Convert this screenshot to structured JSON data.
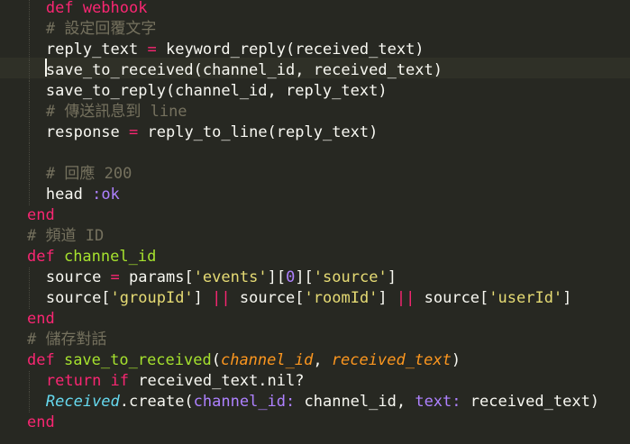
{
  "editor": {
    "lines": [
      {
        "indent": 2,
        "tokens": [
          {
            "t": "def webhook",
            "c": "kw"
          }
        ]
      },
      {
        "indent": 2,
        "tokens": [
          {
            "t": "# 設定回覆文字",
            "c": "cm"
          }
        ]
      },
      {
        "indent": 2,
        "tokens": [
          {
            "t": "reply_text ",
            "c": "plain"
          },
          {
            "t": "=",
            "c": "op"
          },
          {
            "t": " keyword_reply(received_text)",
            "c": "plain"
          }
        ]
      },
      {
        "indent": 2,
        "tokens": [
          {
            "t": "save_to_received(channel_id, received_text)",
            "c": "plain"
          }
        ],
        "cursor": true
      },
      {
        "indent": 2,
        "tokens": [
          {
            "t": "save_to_reply(channel_id, reply_text)",
            "c": "plain"
          }
        ]
      },
      {
        "indent": 2,
        "tokens": [
          {
            "t": "# 傳送訊息到 line",
            "c": "cm"
          }
        ]
      },
      {
        "indent": 2,
        "tokens": [
          {
            "t": "response ",
            "c": "plain"
          },
          {
            "t": "=",
            "c": "op"
          },
          {
            "t": " reply_to_line(reply_text)",
            "c": "plain"
          }
        ]
      },
      {
        "indent": 2,
        "tokens": []
      },
      {
        "indent": 2,
        "tokens": [
          {
            "t": "# 回應 200",
            "c": "cm"
          }
        ]
      },
      {
        "indent": 2,
        "tokens": [
          {
            "t": "head ",
            "c": "plain"
          },
          {
            "t": ":ok",
            "c": "sym"
          }
        ]
      },
      {
        "indent": 0,
        "tokens": [
          {
            "t": "end",
            "c": "kw"
          }
        ]
      },
      {
        "indent": 0,
        "tokens": [
          {
            "t": "# 頻道 ID",
            "c": "cm"
          }
        ]
      },
      {
        "indent": 0,
        "tokens": [
          {
            "t": "def ",
            "c": "kw"
          },
          {
            "t": "channel_id",
            "c": "fn"
          }
        ]
      },
      {
        "indent": 2,
        "tokens": [
          {
            "t": "source ",
            "c": "plain"
          },
          {
            "t": "=",
            "c": "op"
          },
          {
            "t": " params[",
            "c": "plain"
          },
          {
            "t": "'events'",
            "c": "str"
          },
          {
            "t": "][",
            "c": "plain"
          },
          {
            "t": "0",
            "c": "num"
          },
          {
            "t": "][",
            "c": "plain"
          },
          {
            "t": "'source'",
            "c": "str"
          },
          {
            "t": "]",
            "c": "plain"
          }
        ]
      },
      {
        "indent": 2,
        "tokens": [
          {
            "t": "source[",
            "c": "plain"
          },
          {
            "t": "'groupId'",
            "c": "str"
          },
          {
            "t": "] ",
            "c": "plain"
          },
          {
            "t": "||",
            "c": "op"
          },
          {
            "t": " source[",
            "c": "plain"
          },
          {
            "t": "'roomId'",
            "c": "str"
          },
          {
            "t": "] ",
            "c": "plain"
          },
          {
            "t": "||",
            "c": "op"
          },
          {
            "t": " source[",
            "c": "plain"
          },
          {
            "t": "'userId'",
            "c": "str"
          },
          {
            "t": "]",
            "c": "plain"
          }
        ]
      },
      {
        "indent": 0,
        "tokens": [
          {
            "t": "end",
            "c": "kw"
          }
        ]
      },
      {
        "indent": 0,
        "tokens": [
          {
            "t": "# 儲存對話",
            "c": "cm"
          }
        ]
      },
      {
        "indent": 0,
        "tokens": [
          {
            "t": "def ",
            "c": "kw"
          },
          {
            "t": "save_to_received",
            "c": "fn"
          },
          {
            "t": "(",
            "c": "plain"
          },
          {
            "t": "channel_id",
            "c": "param"
          },
          {
            "t": ", ",
            "c": "plain"
          },
          {
            "t": "received_text",
            "c": "param"
          },
          {
            "t": ")",
            "c": "plain"
          }
        ]
      },
      {
        "indent": 2,
        "tokens": [
          {
            "t": "return if",
            "c": "kw"
          },
          {
            "t": " received_text.nil?",
            "c": "plain"
          }
        ]
      },
      {
        "indent": 2,
        "tokens": [
          {
            "t": "Received",
            "c": "cls"
          },
          {
            "t": ".create(",
            "c": "plain"
          },
          {
            "t": "channel_id:",
            "c": "key"
          },
          {
            "t": " channel_id, ",
            "c": "plain"
          },
          {
            "t": "text:",
            "c": "key"
          },
          {
            "t": " received_text)",
            "c": "plain"
          }
        ]
      },
      {
        "indent": 0,
        "tokens": [
          {
            "t": "end",
            "c": "kw"
          }
        ]
      }
    ]
  }
}
